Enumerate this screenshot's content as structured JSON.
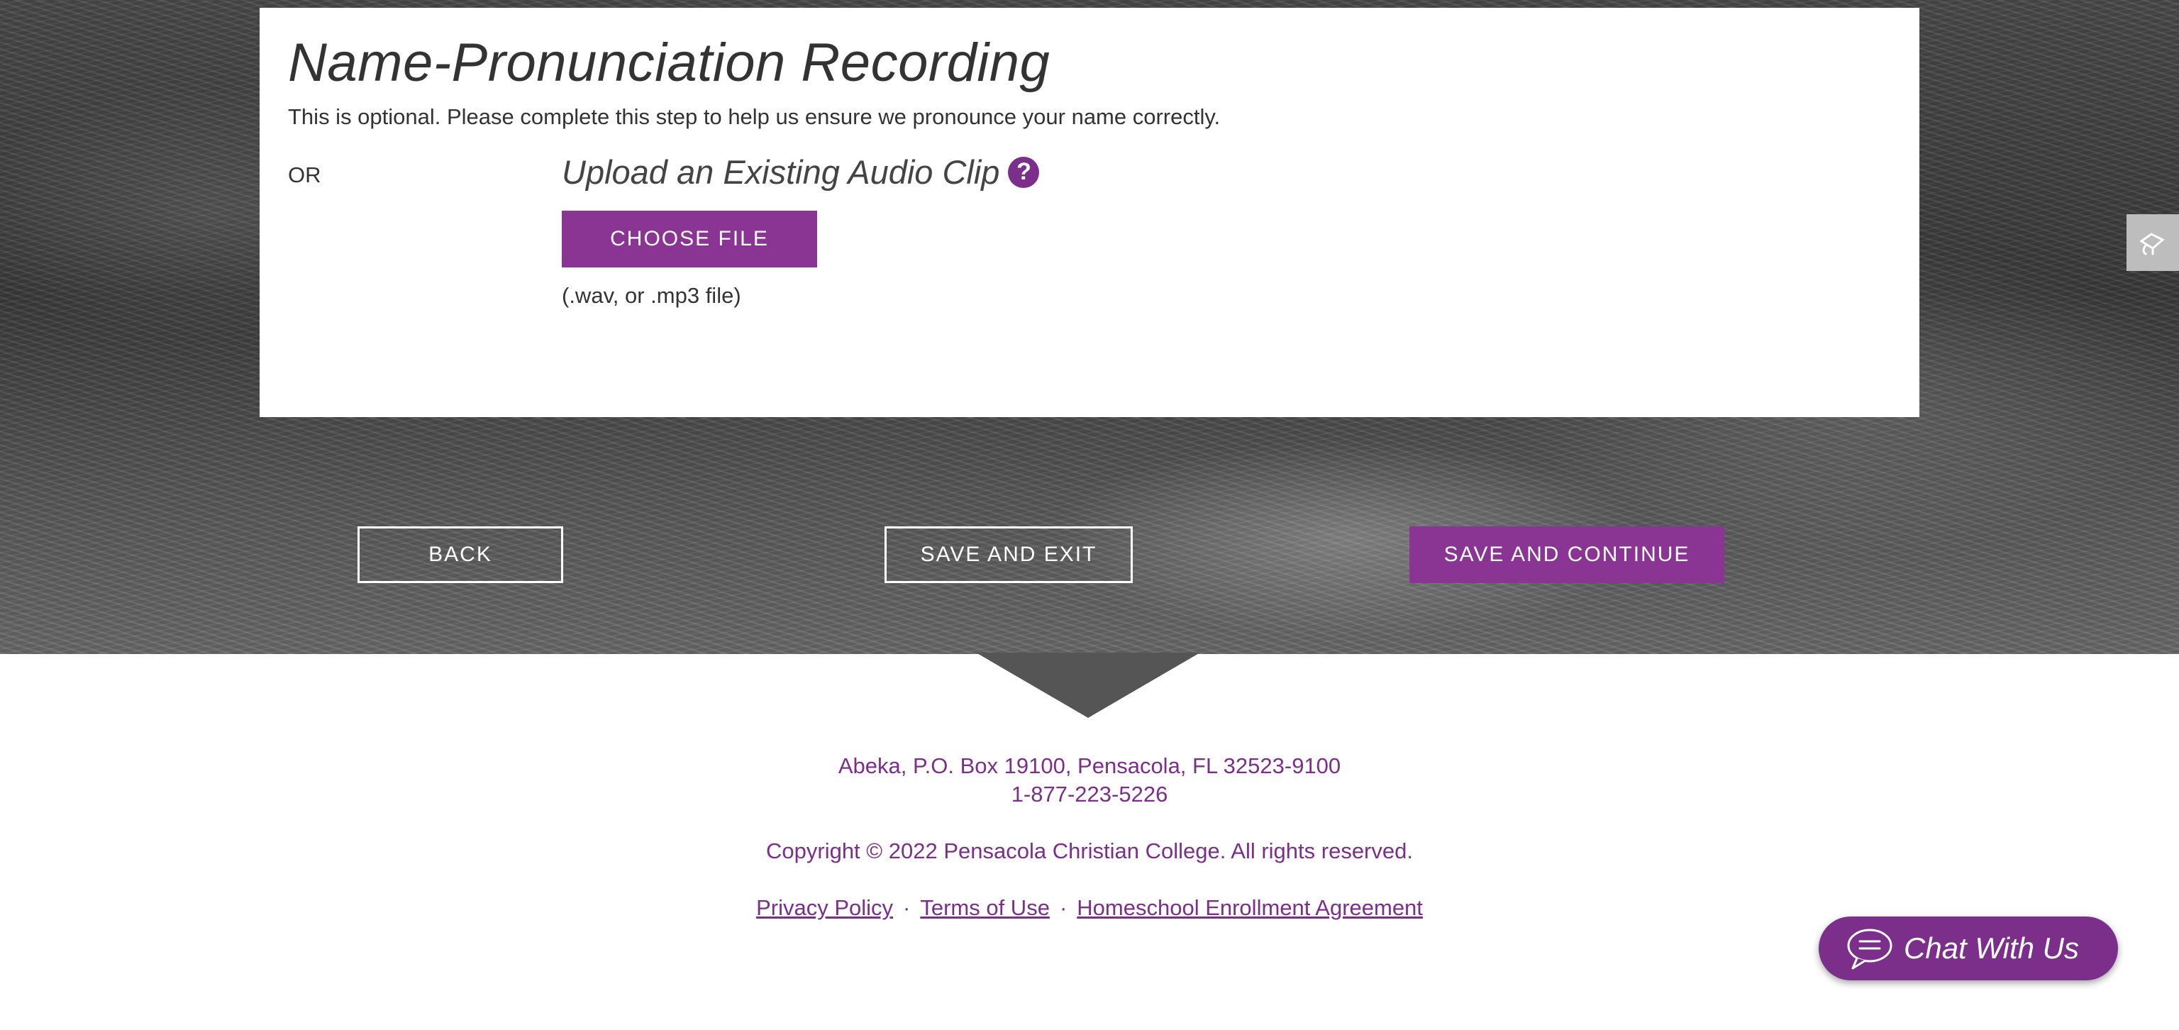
{
  "card": {
    "title": "Name-Pronunciation Recording",
    "intro": "This is optional. Please complete this step to help us ensure we pronounce your name correctly.",
    "or_label": "OR",
    "upload_heading": "Upload an Existing Audio Clip",
    "help_icon": "question-circle-icon",
    "choose_file_label": "CHOOSE FILE",
    "file_hint": "(.wav, or .mp3 file)"
  },
  "navigation": {
    "back_label": "BACK",
    "save_exit_label": "SAVE AND EXIT",
    "save_continue_label": "SAVE AND CONTINUE"
  },
  "side_tab": {
    "icon": "accessibility-icon"
  },
  "footer": {
    "address": "Abeka, P.O. Box 19100, Pensacola, FL  32523-9100",
    "phone": "1-877-223-5226",
    "copyright": "Copyright © 2022 Pensacola Christian College. All rights reserved.",
    "links": [
      "Privacy Policy",
      "Terms of Use",
      "Homeschool Enrollment Agreement"
    ]
  },
  "chat": {
    "label": "Chat With Us",
    "icon": "chat-bubble-icon"
  },
  "colors": {
    "brand_purple": "#8a3494",
    "text_dark": "#333333",
    "white": "#ffffff"
  }
}
